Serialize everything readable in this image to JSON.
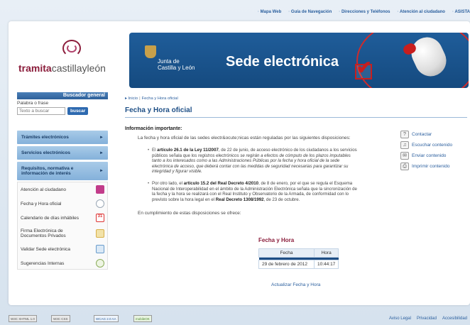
{
  "top_nav": [
    "Mapa Web",
    "Guía de Navegación",
    "Direcciones y Teléfonos",
    "Atención al ciudadano",
    "ASISTA"
  ],
  "logo": {
    "word1": "tramita",
    "word2": "castillayleón"
  },
  "banner": {
    "junta_line1": "Junta de",
    "junta_line2": "Castilla y León",
    "title": "Sede electrónica"
  },
  "search": {
    "heading": "Buscador general",
    "label": "Palabra o frase",
    "placeholder": "Texto a buscar",
    "button": "buscar"
  },
  "nav_blue": [
    "Trámites electrónicos",
    "Servicios electrónicos",
    "Requisitos, normativa e información de interés"
  ],
  "nav_list": [
    {
      "label": "Atención al ciudadano",
      "icon": "people-icon",
      "color": "#c23c8a"
    },
    {
      "label": "Fecha y Hora oficial",
      "icon": "clock-icon",
      "color": "#9aa7b5"
    },
    {
      "label": "Calendario de días inhábiles",
      "icon": "calendar-icon",
      "color": "#d33"
    },
    {
      "label": "Firma Electrónica de Documentos Privados",
      "icon": "document-pen-icon",
      "color": "#d8b04a"
    },
    {
      "label": "Validar Sede electrónica",
      "icon": "validate-icon",
      "color": "#6a9ccc"
    },
    {
      "label": "Sugerencias Internas",
      "icon": "search-person-icon",
      "color": "#8cae5c"
    }
  ],
  "breadcrumb": {
    "home": "Inicio",
    "current": "Fecha y Hora oficial"
  },
  "page_title": "Fecha y Hora oficial",
  "info_heading": "Información importante:",
  "intro": "La fecha y hora oficial de las sedes electr&ocute;nicas están reguladas por las siguientes disposiciones:",
  "bullet1": {
    "pre": "El ",
    "bold": "artículo 26.1 de la Ley 11/2007",
    "mid": ", de 22 de junio, de acceso electrónico de los ciudadanos a los servicios públicos señala que ",
    "italic": "los registros electrónicos se regirán a efectos de cómputo de los plazos imputables tanto a los interesados como a las Administraciones Públicas por la fecha y hora oficial de la sede electrónica de acceso, que deberá contar con las medidas de seguridad necesarias para garantizar su integridad y figurar visible."
  },
  "bullet2": {
    "pre": "Por otro lado, el ",
    "bold1": "artículo 15.2 del Real Decreto 4/2010",
    "mid": ", de 8 de enero, por el que se regula el Esquema Nacional de Interoperabilidad en el ámbito de la Administración Electrónica señala que la sincronización de la fecha y la hora se realizará con el Real Instituto y Observatorio de la Armada, de conformidad con lo previsto sobre la hora legal en el ",
    "bold2": "Real Decreto 1308/1992",
    "post": ", de 23 de octubre."
  },
  "compliance": "En cumplimiento de estas disposiciones se ofrece:",
  "datetime": {
    "title": "Fecha y Hora",
    "col_date": "Fecha",
    "col_time": "Hora",
    "date": "29 de febrero de 2012",
    "time": "10:44:17",
    "update": "Actualizar Fecha y Hora"
  },
  "tools": [
    {
      "label": "Contactar",
      "icon": "contact-icon",
      "glyph": "?"
    },
    {
      "label": "Escuchar contenido",
      "icon": "speaker-icon",
      "glyph": "♫"
    },
    {
      "label": "Enviar contenido",
      "icon": "envelope-icon",
      "glyph": "✉"
    },
    {
      "label": "Imprimir contenido",
      "icon": "printer-icon",
      "glyph": "⎙"
    }
  ],
  "footer": {
    "badges": [
      "W3C XHTML 1.0",
      "W3C CSS",
      "WCAG 2.0 AA",
      "mobileOK"
    ],
    "links": [
      "Aviso Legal",
      "Privacidad",
      "Accesibilidad"
    ]
  }
}
